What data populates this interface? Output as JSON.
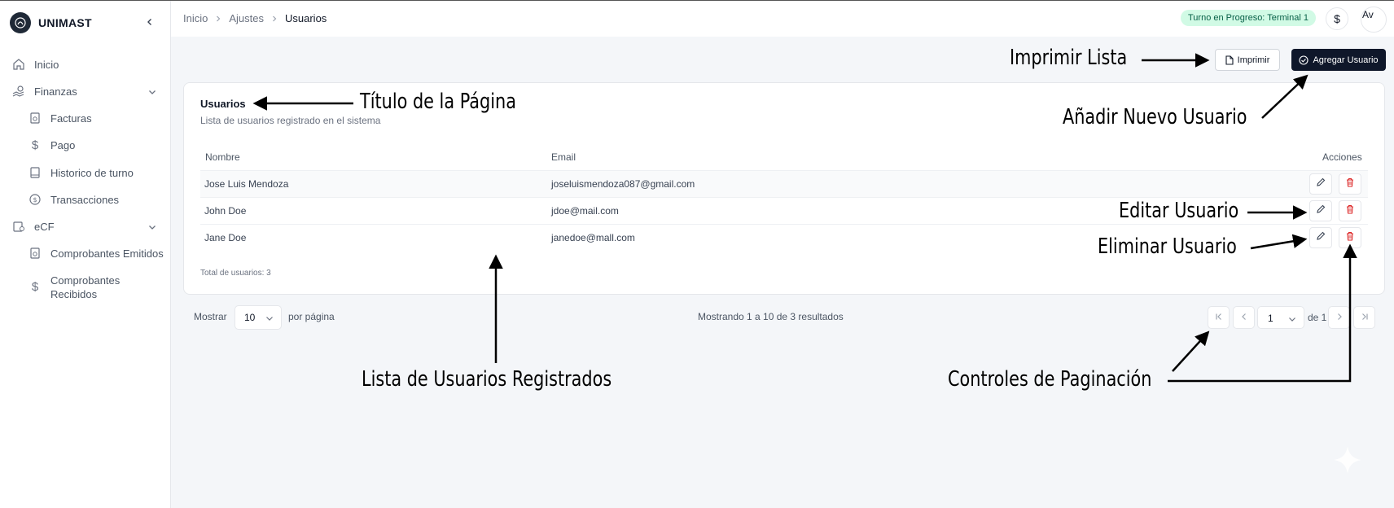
{
  "app": {
    "name": "UNIMAST"
  },
  "sidebar": {
    "items": [
      {
        "label": "Inicio"
      },
      {
        "label": "Finanzas"
      },
      {
        "label": "Facturas"
      },
      {
        "label": "Pago"
      },
      {
        "label": "Historico de turno"
      },
      {
        "label": "Transacciones"
      },
      {
        "label": "eCF"
      },
      {
        "label": "Comprobantes Emitidos"
      },
      {
        "label": "Comprobantes"
      },
      {
        "label": "Recibidos"
      }
    ]
  },
  "header": {
    "breadcrumb": [
      "Inicio",
      "Ajustes",
      "Usuarios"
    ],
    "status_badge": "Turno en Progreso: Terminal 1",
    "currency_symbol": "$",
    "avatar_alt": "Av"
  },
  "toolbar": {
    "print_label": "Imprimir",
    "add_label": "Agregar Usuario"
  },
  "card": {
    "title": "Usuarios",
    "subtitle": "Lista de usuarios registrado en el sistema",
    "columns": [
      "Nombre",
      "Email",
      "Acciones"
    ],
    "rows": [
      {
        "name": "Jose Luis Mendoza",
        "email": "joseluismendoza087@gmail.com"
      },
      {
        "name": "John Doe",
        "email": "jdoe@mail.com"
      },
      {
        "name": "Jane Doe",
        "email": "janedoe@mall.com"
      }
    ],
    "total": "Total de usuarios: 3"
  },
  "pagination": {
    "show_label": "Mostrar",
    "per_page_value": "10",
    "per_page_label": "por página",
    "info": "Mostrando 1 a 10 de 3 resultados",
    "current_page": "1",
    "of_label": "de 1"
  },
  "annotations": {
    "print_list": "Imprimir Lista",
    "page_title": "Título de la Página",
    "add_user": "Añadir Nuevo Usuario",
    "edit_user": "Editar Usuario",
    "delete_user": "Eliminar Usuario",
    "user_list": "Lista de Usuarios Registrados",
    "pagination": "Controles de Paginación"
  },
  "colors": {
    "primary": "#0f172a",
    "badge_bg": "#d1fae5",
    "badge_text": "#065f46",
    "danger": "#dc2626",
    "background": "#f4f6f9"
  }
}
